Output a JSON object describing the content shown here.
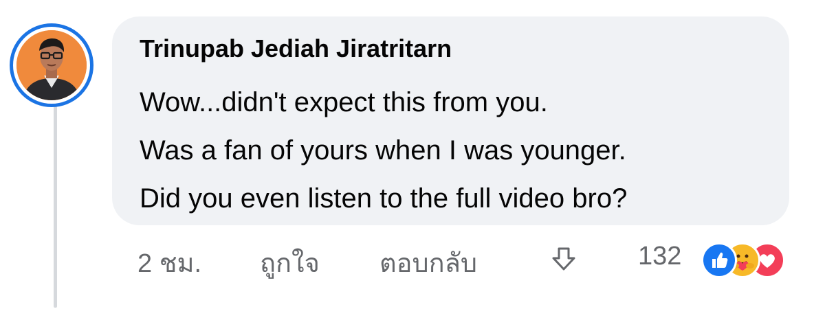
{
  "comment": {
    "author": "Trinupab Jediah Jiratritarn",
    "lines": [
      "Wow...didn't expect this from you.",
      "Was a fan of yours when I was younger.",
      "Did you even listen to the full video bro?"
    ]
  },
  "actions": {
    "time": "2 ชม.",
    "like": "ถูกใจ",
    "reply": "ตอบกลับ",
    "downvote_icon": "arrow-down-icon"
  },
  "reactions": {
    "count": "132",
    "icons": [
      "like-reaction-icon",
      "care-reaction-icon",
      "love-reaction-icon"
    ]
  },
  "colors": {
    "avatar_ring": "#1b74e4",
    "bubble": "#f0f2f5",
    "meta_text": "#65676b",
    "like": "#1877f2",
    "care": "#f7b928",
    "love": "#f33e58"
  }
}
